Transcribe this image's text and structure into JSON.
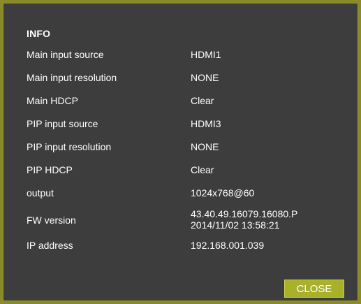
{
  "dialog": {
    "title": "INFO",
    "rows": [
      {
        "label": "Main input source",
        "value": "HDMI1"
      },
      {
        "label": "Main input resolution",
        "value": "NONE"
      },
      {
        "label": "Main HDCP",
        "value": "Clear"
      },
      {
        "label": "PIP input source",
        "value": "HDMI3"
      },
      {
        "label": "PIP input resolution",
        "value": "NONE"
      },
      {
        "label": "PIP HDCP",
        "value": "Clear"
      },
      {
        "label": "output",
        "value": "1024x768@60"
      },
      {
        "label": "FW version",
        "value": "43.40.49.16079.16080.P",
        "value2": "2014/11/02 13:58:21"
      },
      {
        "label": "IP address",
        "value": "192.168.001.039"
      }
    ],
    "close_label": "CLOSE"
  },
  "colors": {
    "dialog_bg": "#3d3d3d",
    "border": "#8f9a1e",
    "button_bg": "#a9b12a",
    "text": "#ffffff"
  }
}
